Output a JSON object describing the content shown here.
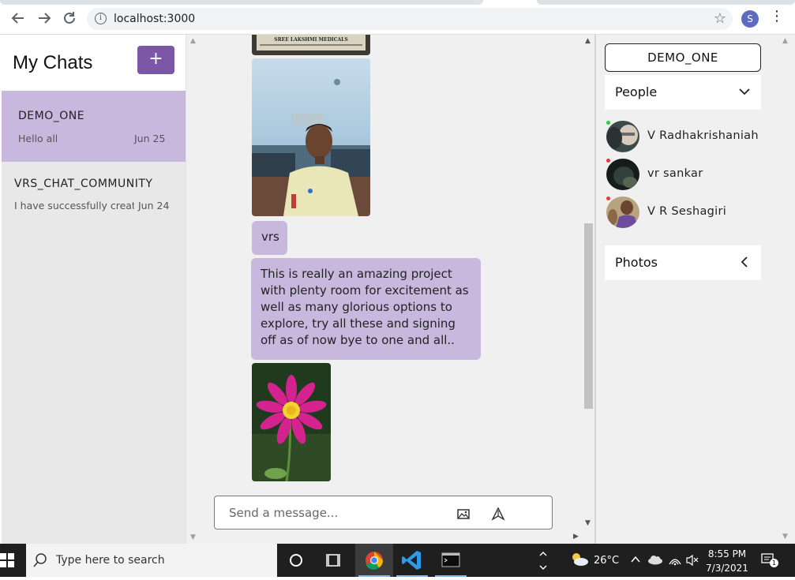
{
  "browser": {
    "url": "localhost:3000",
    "profile_initial": "S",
    "back_icon": "arrow-left-icon",
    "forward_icon": "arrow-right-icon",
    "reload_icon": "reload-icon"
  },
  "left_pane": {
    "title": "My Chats",
    "add_label": "+",
    "chats": [
      {
        "name": "DEMO_ONE",
        "last_message": "Hello all",
        "date": "Jun 25",
        "active": true
      },
      {
        "name": "VRS_CHAT_COMMUNITY",
        "last_message": "I have successfully created",
        "date": "Jun 24",
        "active": false
      }
    ]
  },
  "messages": {
    "short_text": "vrs",
    "long_text": "This is really an amazing project with plenty room for excitement as well as many glorious options to explore, try all these and signing off as of now bye to one and all..",
    "partial_image_caption": "SREE LAKSHMI MEDICALS",
    "composer_placeholder": "Send a message..."
  },
  "right_pane": {
    "chat_title": "DEMO_ONE",
    "people_label": "People",
    "people": [
      {
        "name": "V Radhakrishaniah",
        "status_color": "#2ecc40"
      },
      {
        "name": "vr sankar",
        "status_color": "#e53935"
      },
      {
        "name": "V R Seshagiri",
        "status_color": "#e53935"
      }
    ],
    "photos_label": "Photos"
  },
  "taskbar": {
    "search_placeholder": "Type here to search",
    "weather": "26°C",
    "time": "8:55 PM",
    "date": "7/3/2021",
    "notification_count": "1"
  },
  "colors": {
    "accent": "#7b57a6",
    "bubble": "#c9b8de",
    "pane_bg": "#f0f0f0"
  }
}
